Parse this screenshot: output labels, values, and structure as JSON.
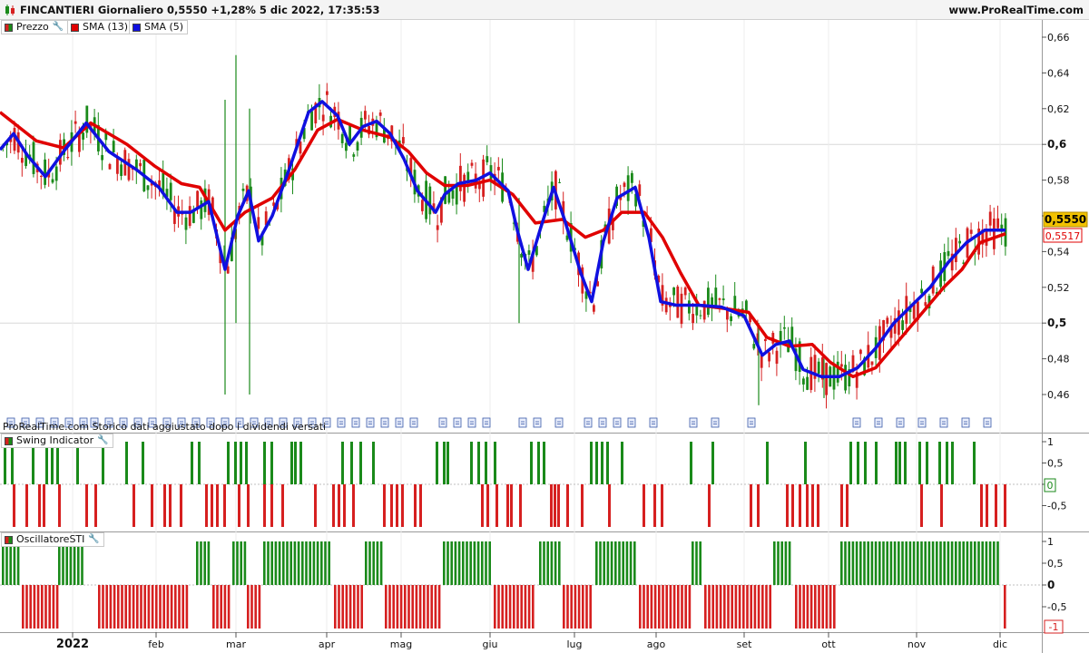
{
  "window": {
    "title": "FINCANTIERI Giornaliero 0,5550 +1,28% 5 dic 2022, 17:35:53",
    "site": "www.ProRealTime.com"
  },
  "main_pane": {
    "legend": [
      {
        "label": "Prezzo",
        "color": "#1a8a1a"
      },
      {
        "label": "SMA (13)",
        "color": "#e00000"
      },
      {
        "label": "SMA (5)",
        "color": "#1010e0"
      }
    ],
    "y_ticks": [
      "0,66",
      "0,64",
      "0,62",
      "0,6",
      "0,58",
      "0,56",
      "0,54",
      "0,52",
      "0,5",
      "0,48",
      "0,46"
    ],
    "last_price_label": "0,5550",
    "sma13_label": "0,5517",
    "history_note": "ProRealTime.com Storico dati aggiustato dopo i dividendi versati"
  },
  "swing_pane": {
    "legend": "Swing Indicator",
    "y_ticks": [
      "1",
      "0,5",
      "0",
      "-0,5"
    ],
    "current_label": "0"
  },
  "sti_pane": {
    "legend": "OscillatoreSTI",
    "y_ticks": [
      "1",
      "0,5",
      "0",
      "-0,5"
    ],
    "current_label": "-1"
  },
  "x_axis": {
    "labels": [
      "2022",
      "feb",
      "mar",
      "apr",
      "mag",
      "giu",
      "lug",
      "ago",
      "set",
      "ott",
      "nov",
      "dic"
    ]
  },
  "colors": {
    "up": "#1a8a1a",
    "down": "#d62020",
    "sma13": "#e00000",
    "sma5": "#1010e0",
    "price_tag": "#f2c200"
  },
  "chart_data": {
    "type": "line",
    "title": "FINCANTIERI Giornaliero",
    "ylim": [
      0.45,
      0.67
    ],
    "x": [
      "2022",
      "feb",
      "mar",
      "apr",
      "mag",
      "giu",
      "lug",
      "ago",
      "set",
      "ott",
      "nov",
      "dic"
    ],
    "series": [
      {
        "name": "SMA (13)",
        "values": [
          0.612,
          0.596,
          0.555,
          0.612,
          0.575,
          0.56,
          0.568,
          0.512,
          0.485,
          0.47,
          0.505,
          0.552
        ]
      },
      {
        "name": "SMA (5)",
        "values": [
          0.602,
          0.565,
          0.556,
          0.624,
          0.575,
          0.528,
          0.574,
          0.51,
          0.48,
          0.474,
          0.52,
          0.555
        ]
      }
    ]
  }
}
